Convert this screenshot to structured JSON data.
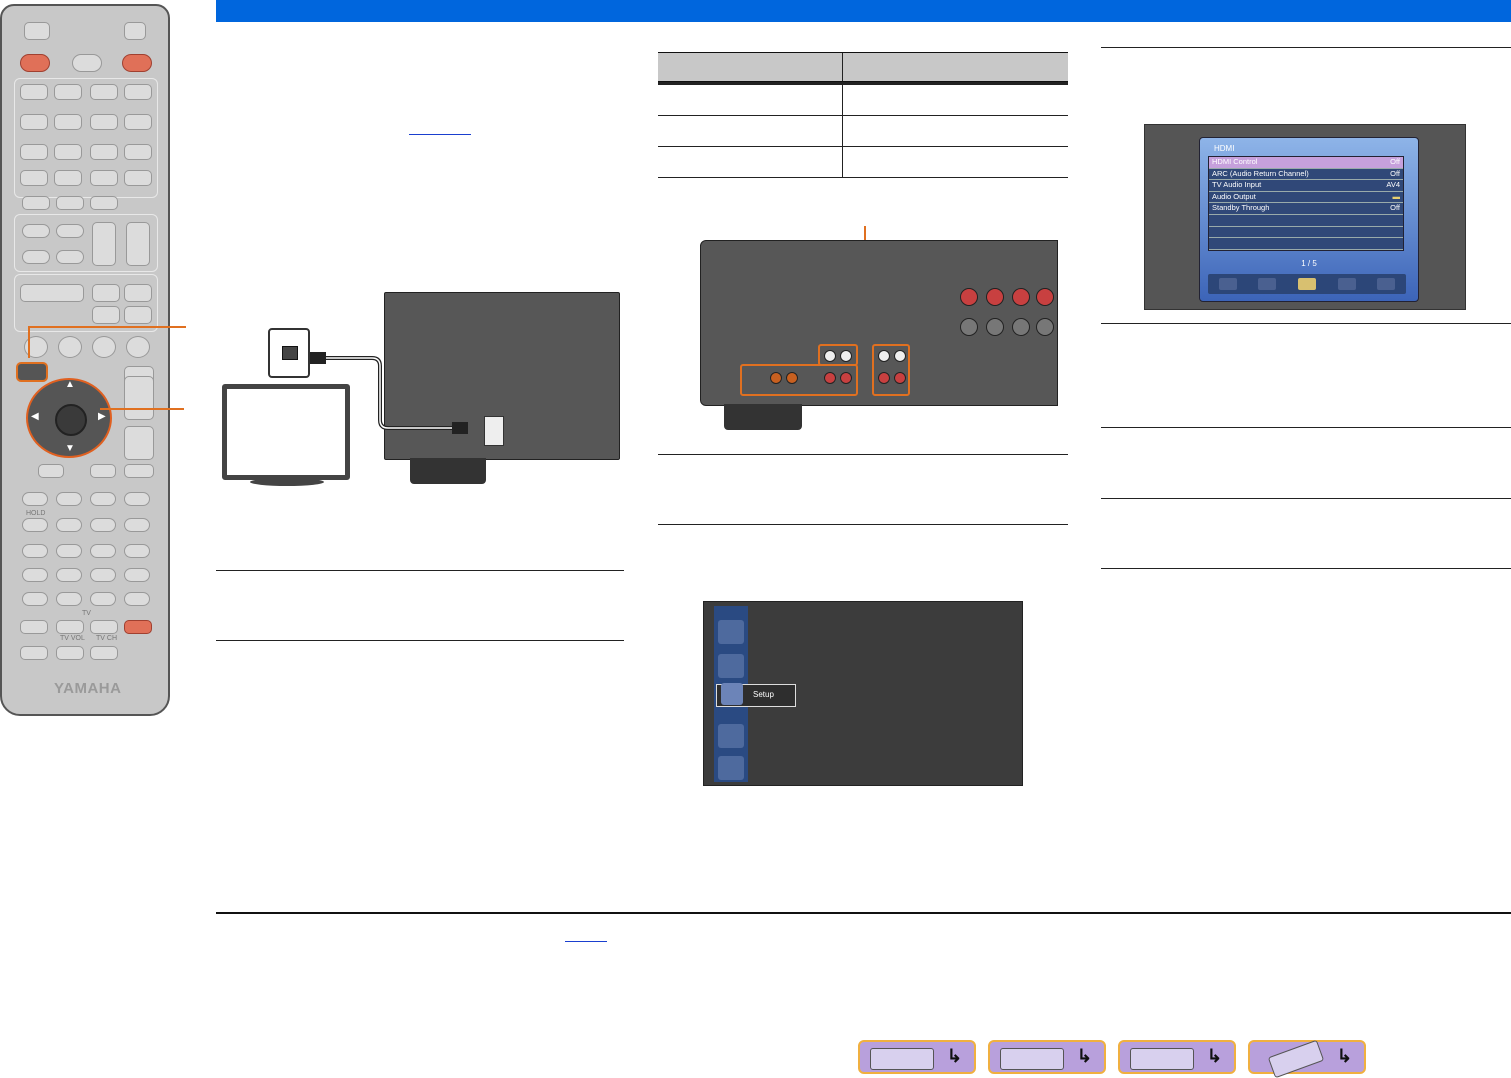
{
  "remote": {
    "brand": "YAMAHA",
    "labels": {
      "hold": "HOLD",
      "tv": "TV",
      "tv_vol": "TV VOL",
      "tv_ch": "TV CH"
    }
  },
  "hdmi_menu": {
    "title": "HDMI",
    "rows": [
      {
        "label": "HDMI Control",
        "value": "Off"
      },
      {
        "label": "ARC (Audio Return Channel)",
        "value": "Off"
      },
      {
        "label": "TV Audio Input",
        "value": "AV4"
      },
      {
        "label": "Audio Output",
        "value": ""
      },
      {
        "label": "Standby Through",
        "value": "Off"
      }
    ],
    "page": "1 / 5"
  },
  "setup_menu": {
    "selected": "Setup"
  },
  "accent": {
    "topbar": "#0066dd",
    "highlight": "#e07020",
    "link": "#1a3fcf"
  }
}
